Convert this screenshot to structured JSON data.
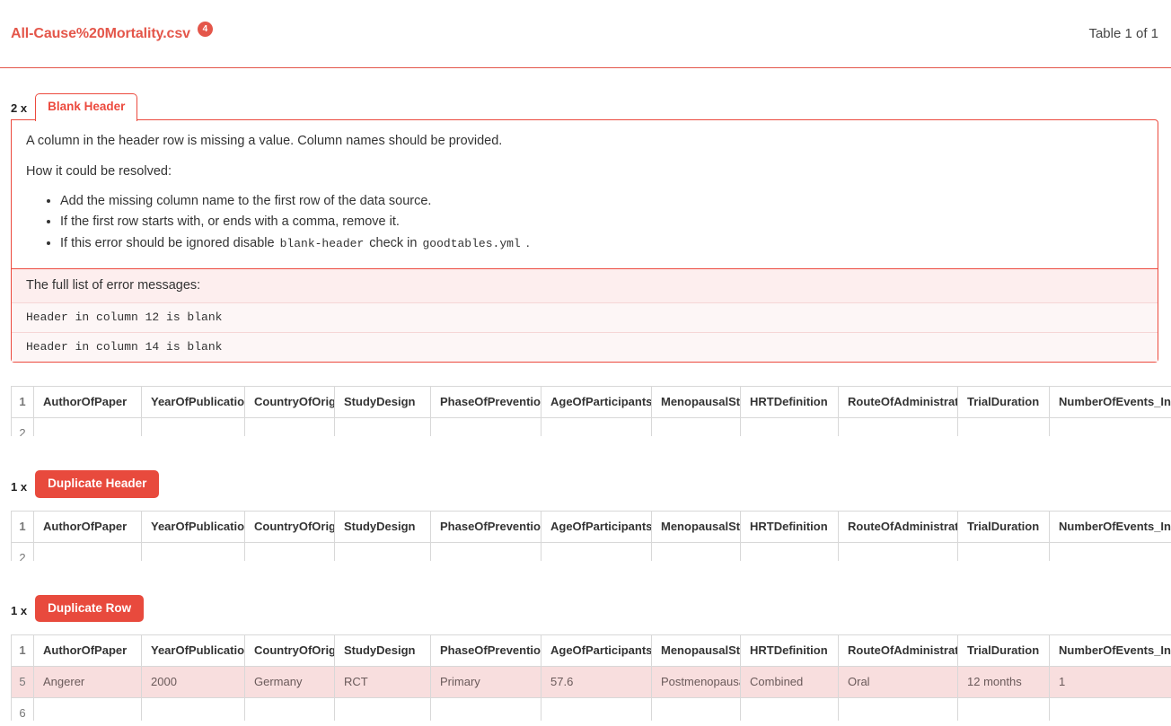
{
  "header": {
    "file_title": "All-Cause%20Mortality.csv",
    "error_count_badge": "4",
    "table_count": "Table 1 of 1",
    "accent_color": "#e4564a"
  },
  "columns": [
    "AuthorOfPaper",
    "YearOfPublication",
    "CountryOfOrigin",
    "StudyDesign",
    "PhaseOfPrevention",
    "AgeOfParticipants",
    "MenopausalStatus",
    "HRTDefinition",
    "RouteOfAdministration",
    "TrialDuration",
    "NumberOfEvents_Inte"
  ],
  "groups": [
    {
      "count_label": "2 x",
      "title": "Blank Header",
      "state": "open",
      "description": "A column in the header row is missing a value. Column names should be provided.",
      "resolve_label": "How it could be resolved:",
      "resolutions": [
        {
          "pre": "Add the missing column name to the first row of the data source.",
          "code1": "",
          "mid": "",
          "code2": "",
          "post": ""
        },
        {
          "pre": "If the first row starts with, or ends with a comma, remove it.",
          "code1": "",
          "mid": "",
          "code2": "",
          "post": ""
        },
        {
          "pre": "If this error should be ignored disable ",
          "code1": "blank-header",
          "mid": " check in ",
          "code2": "goodtables.yml",
          "post": " ."
        }
      ],
      "error_list_label": "The full list of error messages:",
      "error_messages": [
        "Header in column 12 is blank",
        "Header in column 14 is blank"
      ],
      "table": {
        "header_rownum": "1",
        "rows": [
          {
            "rownum": "2",
            "highlight": false,
            "clipped": true,
            "cells": [
              "",
              "",
              "",
              "",
              "",
              "",
              "",
              "",
              "",
              "",
              ""
            ]
          }
        ]
      }
    },
    {
      "count_label": "1 x",
      "title": "Duplicate Header",
      "state": "closed",
      "table": {
        "header_rownum": "1",
        "rows": [
          {
            "rownum": "2",
            "highlight": false,
            "clipped": true,
            "cells": [
              "",
              "",
              "",
              "",
              "",
              "",
              "",
              "",
              "",
              "",
              ""
            ]
          }
        ]
      }
    },
    {
      "count_label": "1 x",
      "title": "Duplicate Row",
      "state": "closed",
      "table": {
        "header_rownum": "1",
        "rows": [
          {
            "rownum": "5",
            "highlight": true,
            "clipped": false,
            "cells": [
              "Angerer",
              "2000",
              "Germany",
              "RCT",
              "Primary",
              "57.6",
              "Postmenopausal",
              "Combined",
              "Oral",
              "12 months",
              "1"
            ]
          },
          {
            "rownum": "6",
            "highlight": false,
            "clipped": true,
            "cells": [
              "",
              "",
              "",
              "",
              "",
              "",
              "",
              "",
              "",
              "",
              ""
            ]
          }
        ]
      }
    }
  ]
}
